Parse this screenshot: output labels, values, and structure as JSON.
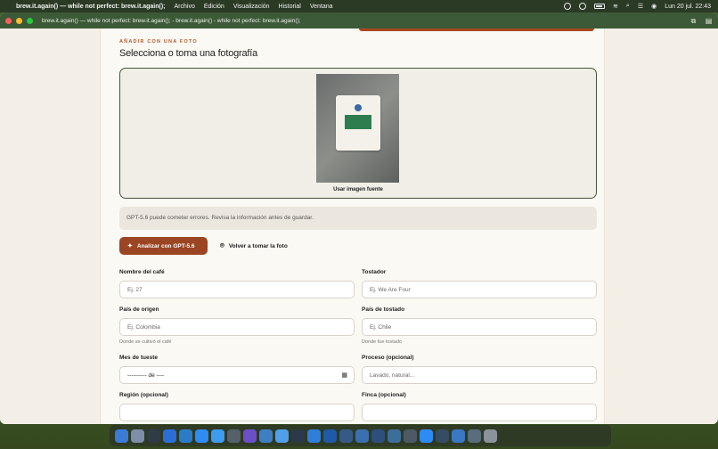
{
  "menubar": {
    "app_name": "brew.it.again() — while not perfect: brew.it.again();",
    "menus": [
      "Archivo",
      "Edición",
      "Visualización",
      "Historial",
      "Ventana"
    ],
    "clock": "Lun 20 jul. 22:43"
  },
  "window": {
    "title": "brew.it.again() — while not perfect: brew.it.again(); - brew.it.again() - while not perfect: brew.it.again();"
  },
  "photo_section": {
    "kicker": "AÑADIR CON UNA FOTO",
    "title": "Selecciona o toma una fotografía",
    "caption": "Usar imagen fuente"
  },
  "notice": "GPT-5.6 puede cometer errores. Revisa la información antes de guardar.",
  "actions": {
    "analyze_label": "Analizar con GPT-5.6",
    "retake_label": "Volver a tomar la foto"
  },
  "form": {
    "coffee_name": {
      "label": "Nombre del café",
      "placeholder": "Ej. 27"
    },
    "roaster": {
      "label": "Tostador",
      "placeholder": "Ej. We Are Four"
    },
    "origin_country": {
      "label": "País de origen",
      "placeholder": "Ej. Colombia",
      "help": "Donde se cultivó el café"
    },
    "roast_country": {
      "label": "País de tostado",
      "placeholder": "Ej. Chile",
      "help": "Donde fue tostado"
    },
    "roast_month": {
      "label": "Mes de tueste",
      "value": "---------- de ----"
    },
    "process": {
      "label": "Proceso (opcional)",
      "placeholder": "Lavado, natural..."
    },
    "region": {
      "label": "Región (opcional)",
      "placeholder": ""
    },
    "farm": {
      "label": "Finca (opcional)",
      "placeholder": ""
    }
  },
  "colors": {
    "accent": "#9b4523",
    "window_header": "#3c5a37",
    "photo_border": "#44573a"
  },
  "dock_icons": [
    "finder-icon",
    "launchpad-icon",
    "terminal-icon",
    "browser-icon",
    "vscode-icon",
    "app-store-icon",
    "xcode-icon",
    "settings-icon"
  ]
}
